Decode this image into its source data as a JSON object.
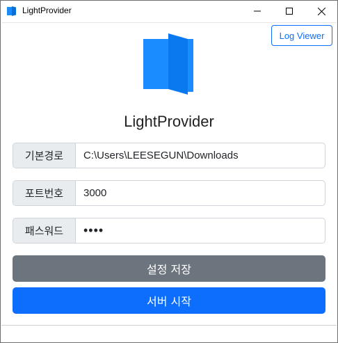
{
  "window": {
    "title": "LightProvider"
  },
  "toolbar": {
    "log_viewer_label": "Log Viewer"
  },
  "app": {
    "name": "LightProvider"
  },
  "fields": [
    {
      "label": "기본경로",
      "value": "C:\\Users\\LEESEGUN\\Downloads"
    },
    {
      "label": "포트번호",
      "value": "3000"
    },
    {
      "label": "패스워드",
      "value": "••••"
    }
  ],
  "actions": {
    "save_label": "설정 저장",
    "start_label": "서버 시작"
  },
  "icons": {
    "app_icon": "door-icon",
    "minimize": "minimize-icon",
    "maximize": "maximize-icon",
    "close": "close-icon"
  },
  "colors": {
    "primary": "#0d6efd",
    "secondary": "#6c757d",
    "logo": "#1a8cff"
  }
}
